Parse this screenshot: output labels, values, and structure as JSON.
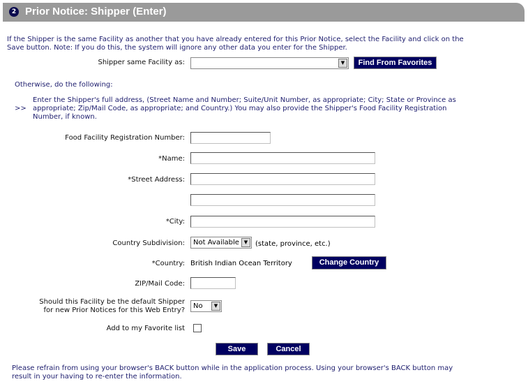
{
  "header": {
    "step": "2",
    "title": "Prior Notice: Shipper (Enter)"
  },
  "intro": [
    "If the Shipper is the same Facility as another that you have already entered for this Prior Notice, select the Facility and click on the",
    "Save button. Note: If you do this, the system will ignore any other data you enter for the Shipper."
  ],
  "same_facility": {
    "label": "Shipper same Facility as:",
    "value": "",
    "button": "Find From Favorites"
  },
  "otherwise": "Otherwise, do the following:",
  "instructions": {
    "marker": ">>",
    "lines": [
      "Enter the Shipper's full address, (Street Name and Number; Suite/Unit Number, as appropriate; City; State or Province as",
      "appropriate; Zip/Mail Code, as appropriate; and Country.) You may also provide the Shipper's Food Facility Registration",
      "Number, if known."
    ]
  },
  "form": {
    "ffrn_label": "Food Facility Registration Number:",
    "name_label": "*Name:",
    "street_label": "*Street Address:",
    "city_label": "*City:",
    "subdivision_label": "Country Subdivision:",
    "subdivision_value": "Not Available",
    "subdivision_hint": "(state, province, etc.)",
    "country_label": "*Country:",
    "country_value": "British Indian Ocean Territory",
    "change_country": "Change Country",
    "zip_label": "ZIP/Mail Code:",
    "default_label_1": "Should this Facility be the default Shipper",
    "default_label_2": "for new Prior Notices for this Web Entry?",
    "default_value": "No",
    "favorite_label": "Add to my Favorite list",
    "favorite_checked": false
  },
  "actions": {
    "save": "Save",
    "cancel": "Cancel"
  },
  "footer": [
    "Please refrain from using your browser's BACK button while in the application process. Using your browser's BACK button may",
    "result in your having to re-enter the information."
  ]
}
